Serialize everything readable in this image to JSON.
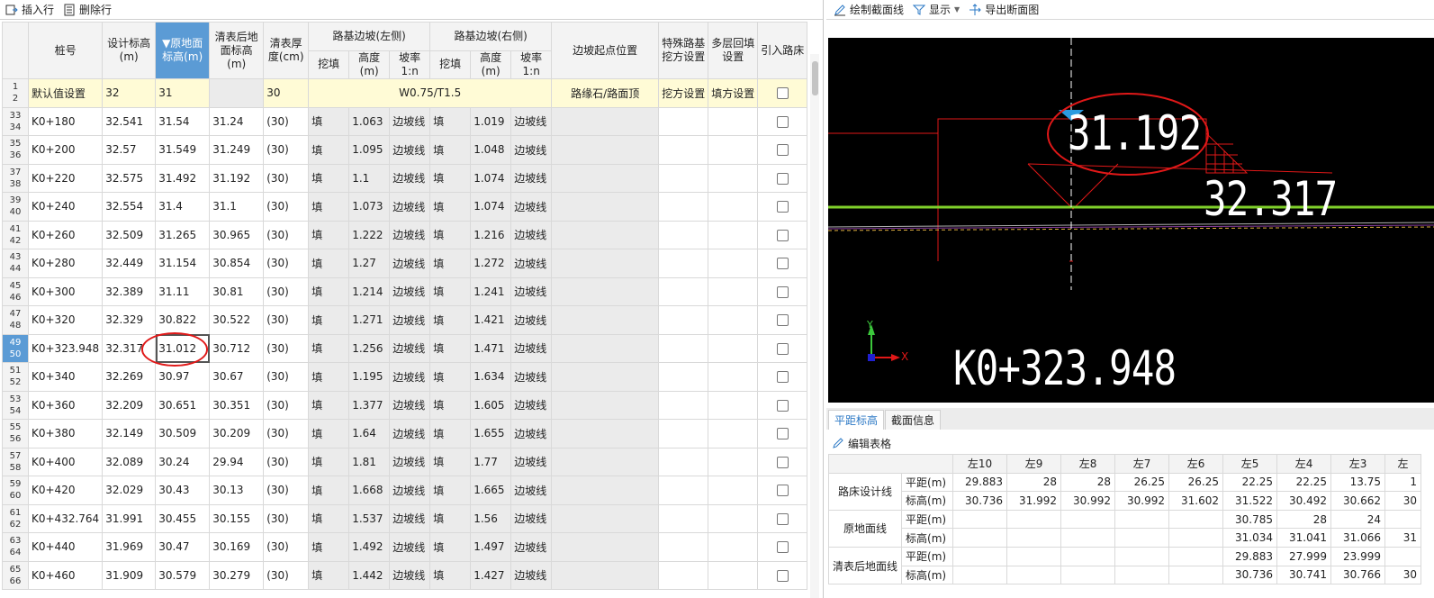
{
  "toolbar": {
    "insert_row": "插入行",
    "delete_row": "删除行"
  },
  "grid": {
    "headers": {
      "station": "桩号",
      "design_elev": "设计标高(m)",
      "orig_elev": "▼原地面标高(m)",
      "cleared_elev": "清表后地面标高(m)",
      "clear_thickness": "清表厚度(cm)",
      "left_slope": "路基边坡(左侧)",
      "right_slope": "路基边坡(右侧)",
      "cut_fill": "挖填",
      "height": "高度(m)",
      "ratio": "坡率1:n",
      "slope_start": "边坡起点位置",
      "special_cut": "特殊路基挖方设置",
      "multi_fill": "多层回填设置",
      "lead_subgrade": "引入路床"
    },
    "default_row": {
      "rn1": "1",
      "rn2": "2",
      "label": "默认值设置",
      "design": "32",
      "orig": "31",
      "thick": "30",
      "slope": "W0.75/T1.5",
      "start": "路缘石/路面顶",
      "cut": "挖方设置",
      "fill": "填方设置"
    },
    "rows": [
      {
        "rn1": "33",
        "rn2": "34",
        "station": "K0+180",
        "design": "32.541",
        "orig": "31.54",
        "cleared": "31.24",
        "thick": "(30)",
        "lf": "填",
        "lh": "1.063",
        "ls": "边坡线",
        "rf": "填",
        "rh": "1.019",
        "rs": "边坡线"
      },
      {
        "rn1": "35",
        "rn2": "36",
        "station": "K0+200",
        "design": "32.57",
        "orig": "31.549",
        "cleared": "31.249",
        "thick": "(30)",
        "lf": "填",
        "lh": "1.095",
        "ls": "边坡线",
        "rf": "填",
        "rh": "1.048",
        "rs": "边坡线"
      },
      {
        "rn1": "37",
        "rn2": "38",
        "station": "K0+220",
        "design": "32.575",
        "orig": "31.492",
        "cleared": "31.192",
        "thick": "(30)",
        "lf": "填",
        "lh": "1.1",
        "ls": "边坡线",
        "rf": "填",
        "rh": "1.074",
        "rs": "边坡线"
      },
      {
        "rn1": "39",
        "rn2": "40",
        "station": "K0+240",
        "design": "32.554",
        "orig": "31.4",
        "cleared": "31.1",
        "thick": "(30)",
        "lf": "填",
        "lh": "1.073",
        "ls": "边坡线",
        "rf": "填",
        "rh": "1.074",
        "rs": "边坡线"
      },
      {
        "rn1": "41",
        "rn2": "42",
        "station": "K0+260",
        "design": "32.509",
        "orig": "31.265",
        "cleared": "30.965",
        "thick": "(30)",
        "lf": "填",
        "lh": "1.222",
        "ls": "边坡线",
        "rf": "填",
        "rh": "1.216",
        "rs": "边坡线"
      },
      {
        "rn1": "43",
        "rn2": "44",
        "station": "K0+280",
        "design": "32.449",
        "orig": "31.154",
        "cleared": "30.854",
        "thick": "(30)",
        "lf": "填",
        "lh": "1.27",
        "ls": "边坡线",
        "rf": "填",
        "rh": "1.272",
        "rs": "边坡线"
      },
      {
        "rn1": "45",
        "rn2": "46",
        "station": "K0+300",
        "design": "32.389",
        "orig": "31.11",
        "cleared": "30.81",
        "thick": "(30)",
        "lf": "填",
        "lh": "1.214",
        "ls": "边坡线",
        "rf": "填",
        "rh": "1.241",
        "rs": "边坡线"
      },
      {
        "rn1": "47",
        "rn2": "48",
        "station": "K0+320",
        "design": "32.329",
        "orig": "30.822",
        "cleared": "30.522",
        "thick": "(30)",
        "lf": "填",
        "lh": "1.271",
        "ls": "边坡线",
        "rf": "填",
        "rh": "1.421",
        "rs": "边坡线"
      },
      {
        "rn1": "49",
        "rn2": "50",
        "station": "K0+323.948",
        "design": "32.317",
        "orig": "31.012",
        "cleared": "30.712",
        "thick": "(30)",
        "lf": "填",
        "lh": "1.256",
        "ls": "边坡线",
        "rf": "填",
        "rh": "1.471",
        "rs": "边坡线"
      },
      {
        "rn1": "51",
        "rn2": "52",
        "station": "K0+340",
        "design": "32.269",
        "orig": "30.97",
        "cleared": "30.67",
        "thick": "(30)",
        "lf": "填",
        "lh": "1.195",
        "ls": "边坡线",
        "rf": "填",
        "rh": "1.634",
        "rs": "边坡线"
      },
      {
        "rn1": "53",
        "rn2": "54",
        "station": "K0+360",
        "design": "32.209",
        "orig": "30.651",
        "cleared": "30.351",
        "thick": "(30)",
        "lf": "填",
        "lh": "1.377",
        "ls": "边坡线",
        "rf": "填",
        "rh": "1.605",
        "rs": "边坡线"
      },
      {
        "rn1": "55",
        "rn2": "56",
        "station": "K0+380",
        "design": "32.149",
        "orig": "30.509",
        "cleared": "30.209",
        "thick": "(30)",
        "lf": "填",
        "lh": "1.64",
        "ls": "边坡线",
        "rf": "填",
        "rh": "1.655",
        "rs": "边坡线"
      },
      {
        "rn1": "57",
        "rn2": "58",
        "station": "K0+400",
        "design": "32.089",
        "orig": "30.24",
        "cleared": "29.94",
        "thick": "(30)",
        "lf": "填",
        "lh": "1.81",
        "ls": "边坡线",
        "rf": "填",
        "rh": "1.77",
        "rs": "边坡线"
      },
      {
        "rn1": "59",
        "rn2": "60",
        "station": "K0+420",
        "design": "32.029",
        "orig": "30.43",
        "cleared": "30.13",
        "thick": "(30)",
        "lf": "填",
        "lh": "1.668",
        "ls": "边坡线",
        "rf": "填",
        "rh": "1.665",
        "rs": "边坡线"
      },
      {
        "rn1": "61",
        "rn2": "62",
        "station": "K0+432.764",
        "design": "31.991",
        "orig": "30.455",
        "cleared": "30.155",
        "thick": "(30)",
        "lf": "填",
        "lh": "1.537",
        "ls": "边坡线",
        "rf": "填",
        "rh": "1.56",
        "rs": "边坡线"
      },
      {
        "rn1": "63",
        "rn2": "64",
        "station": "K0+440",
        "design": "31.969",
        "orig": "30.47",
        "cleared": "30.169",
        "thick": "(30)",
        "lf": "填",
        "lh": "1.492",
        "ls": "边坡线",
        "rf": "填",
        "rh": "1.497",
        "rs": "边坡线"
      },
      {
        "rn1": "65",
        "rn2": "66",
        "station": "K0+460",
        "design": "31.909",
        "orig": "30.579",
        "cleared": "30.279",
        "thick": "(30)",
        "lf": "填",
        "lh": "1.442",
        "ls": "边坡线",
        "rf": "填",
        "rh": "1.427",
        "rs": "边坡线"
      }
    ]
  },
  "rtoolbar": {
    "draw": "绘制截面线",
    "display": "显示",
    "export": "导出断面图"
  },
  "canvas": {
    "elev_ground": "31.192",
    "elev_design": "32.317",
    "station": "K0+323.948",
    "axis_x": "X",
    "axis_y": "Y"
  },
  "tabs": {
    "t1": "平距标高",
    "t2": "截面信息"
  },
  "edit_table": "编辑表格",
  "sec": {
    "cols": [
      "左10",
      "左9",
      "左8",
      "左7",
      "左6",
      "左5",
      "左4",
      "左3",
      "左"
    ],
    "groups": [
      "路床设计线",
      "原地面线",
      "清表后地面线"
    ],
    "sub": {
      "dist": "平距(m)",
      "elev": "标高(m)"
    },
    "rows": [
      [
        "29.883",
        "28",
        "28",
        "26.25",
        "26.25",
        "22.25",
        "22.25",
        "13.75",
        "1"
      ],
      [
        "30.736",
        "31.992",
        "30.992",
        "30.992",
        "31.602",
        "31.522",
        "30.492",
        "30.662",
        "30"
      ],
      [
        "",
        "",
        "",
        "",
        "",
        "30.785",
        "28",
        "24",
        ""
      ],
      [
        "",
        "",
        "",
        "",
        "",
        "31.034",
        "31.041",
        "31.066",
        "31"
      ],
      [
        "",
        "",
        "",
        "",
        "",
        "29.883",
        "27.999",
        "23.999",
        ""
      ],
      [
        "",
        "",
        "",
        "",
        "",
        "30.736",
        "30.741",
        "30.766",
        "30"
      ]
    ]
  }
}
